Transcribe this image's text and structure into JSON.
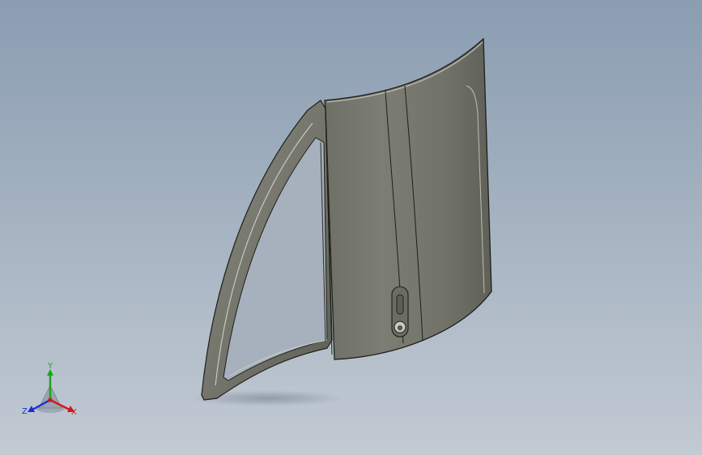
{
  "viewport": {
    "background_top": "#8a9db1",
    "background_bottom": "#c2cad3"
  },
  "model": {
    "part": "car-door-panel",
    "surface_color": "#76776c",
    "frame_color": "#6f7065",
    "edge_color": "#1e1f1a"
  },
  "triad": {
    "y_label": "Y",
    "x_label": "X",
    "z_label": "Z",
    "y_color": "#19a319",
    "x_color": "#d01a1a",
    "z_color": "#1a2fd0"
  }
}
